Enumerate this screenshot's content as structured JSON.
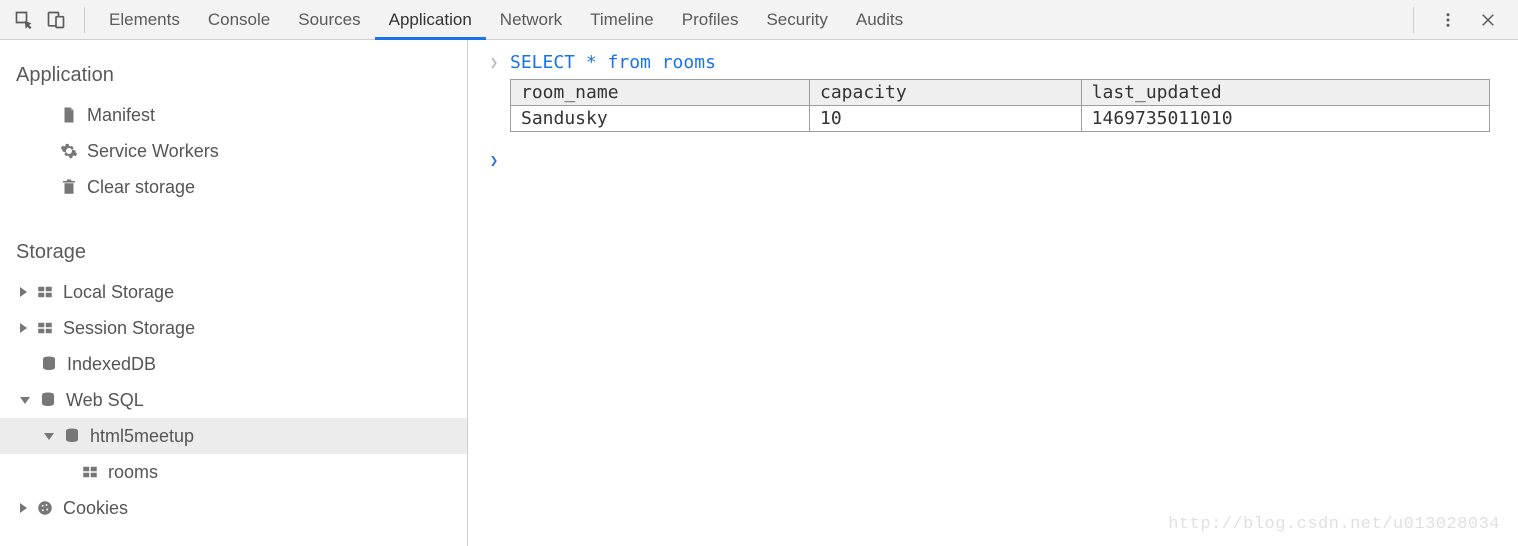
{
  "toolbar": {
    "tabs": [
      "Elements",
      "Console",
      "Sources",
      "Application",
      "Network",
      "Timeline",
      "Profiles",
      "Security",
      "Audits"
    ],
    "active_tab_index": 3
  },
  "sidebar": {
    "sections": {
      "application": {
        "title": "Application",
        "items": [
          {
            "icon": "file-icon",
            "label": "Manifest"
          },
          {
            "icon": "gear-icon",
            "label": "Service Workers"
          },
          {
            "icon": "trash-icon",
            "label": "Clear storage"
          }
        ]
      },
      "storage": {
        "title": "Storage",
        "items": [
          {
            "expand": "collapsed",
            "icon": "table-icon",
            "label": "Local Storage"
          },
          {
            "expand": "collapsed",
            "icon": "table-icon",
            "label": "Session Storage"
          },
          {
            "expand": "none",
            "icon": "database-icon",
            "label": "IndexedDB"
          },
          {
            "expand": "expanded",
            "icon": "database-icon",
            "label": "Web SQL",
            "children": [
              {
                "expand": "expanded",
                "icon": "database-icon",
                "label": "html5meetup",
                "selected": true,
                "children": [
                  {
                    "expand": "none",
                    "icon": "table-icon",
                    "label": "rooms"
                  }
                ]
              }
            ]
          },
          {
            "expand": "collapsed",
            "icon": "cookie-icon",
            "label": "Cookies"
          }
        ]
      }
    }
  },
  "console": {
    "query": "SELECT * from rooms",
    "columns": [
      "room_name",
      "capacity",
      "last_updated"
    ],
    "rows": [
      {
        "room_name": "Sandusky",
        "capacity": "10",
        "last_updated": "1469735011010"
      }
    ]
  },
  "watermark": "http://blog.csdn.net/u013028034"
}
